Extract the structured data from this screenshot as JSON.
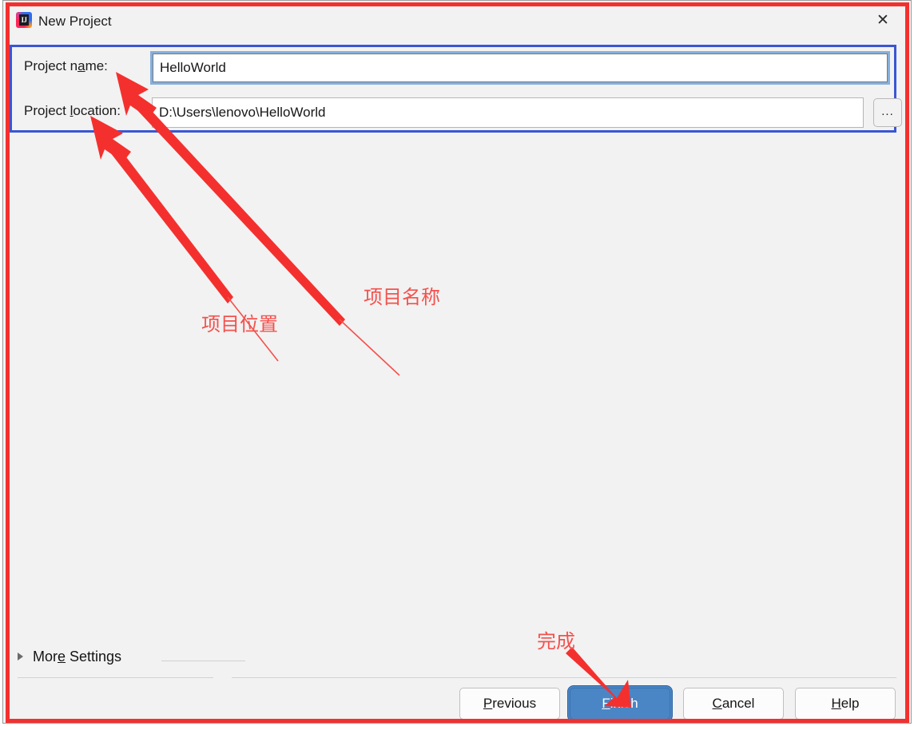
{
  "window": {
    "title": "New Project",
    "app_icon": "intellij-idea-icon",
    "icon_glyph": "IJ",
    "close_icon": "✕"
  },
  "form": {
    "name_field": {
      "label_before": "Project n",
      "label_mnemonic": "a",
      "label_after": "me:",
      "label_full": "Project name:",
      "value": "HelloWorld",
      "placeholder": ""
    },
    "location_field": {
      "label_before": "Project ",
      "label_mnemonic": "l",
      "label_after": "ocation:",
      "label_full": "Project location:",
      "value": "D:\\Users\\lenovo\\HelloWorld",
      "placeholder": "",
      "browse_label": "..."
    }
  },
  "more_settings": {
    "label_before": "Mor",
    "label_mnemonic": "e",
    "label_after": " Settings",
    "label_full": "More Settings",
    "expanded": false,
    "disclosure_icon": "triangle-right-icon"
  },
  "buttons": {
    "previous": {
      "before": "",
      "mnemonic": "P",
      "after": "revious",
      "full": "Previous"
    },
    "finish": {
      "before": "",
      "mnemonic": "F",
      "after": "inish",
      "full": "Finish",
      "primary": true
    },
    "cancel": {
      "before": "",
      "mnemonic": "C",
      "after": "ancel",
      "full": "Cancel"
    },
    "help": {
      "before": "",
      "mnemonic": "H",
      "after": "elp",
      "full": "Help"
    }
  },
  "annotations": {
    "project_name": "项目名称",
    "project_location": "项目位置",
    "finish": "完成"
  },
  "colors": {
    "annotation_red": "#f4302e",
    "annotation_text_red": "#f4514d",
    "highlight_blue": "#3a56d4",
    "focus_ring_blue": "#84b0dd",
    "primary_button_blue": "#4a86c5",
    "dialog_background": "#f2f2f2"
  }
}
